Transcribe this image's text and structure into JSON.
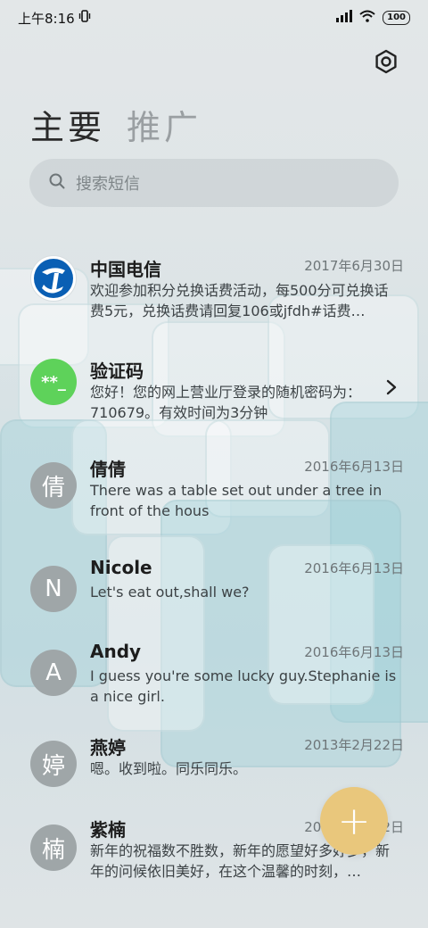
{
  "status_bar": {
    "time": "上午8:16",
    "battery": "100",
    "icons": [
      "vibrate-icon",
      "signal-icon",
      "wifi-icon",
      "battery-icon"
    ]
  },
  "tabs": [
    {
      "label": "主要",
      "active": true
    },
    {
      "label": "推广",
      "active": false
    }
  ],
  "search": {
    "placeholder": "搜索短信",
    "icon": "search-icon"
  },
  "settings": {
    "icon": "gear-icon"
  },
  "messages": [
    {
      "sender": "中国电信",
      "date": "2017年6月30日",
      "preview": "欢迎参加积分兑换话费活动，每500分可兑换话费5元，兑换话费请回复106或jfdh#话费…",
      "avatar": {
        "type": "logo",
        "icon": "china-telecom-logo"
      }
    },
    {
      "sender": "验证码",
      "date": "",
      "preview": "您好！您的网上营业厅登录的随机密码为：710679。有效时间为3分钟",
      "avatar": {
        "type": "code",
        "label": "**_",
        "color": "#5ed25a"
      },
      "has_chevron": true
    },
    {
      "sender": "倩倩",
      "date": "2016年6月13日",
      "preview": "There was a table set out under a tree in front of the hous",
      "avatar": {
        "type": "letter",
        "label": "倩"
      }
    },
    {
      "sender": "Nicole",
      "date": "2016年6月13日",
      "preview": "Let's eat out,shall we?",
      "avatar": {
        "type": "letter",
        "label": "N"
      }
    },
    {
      "sender": "Andy",
      "date": "2016年6月13日",
      "preview": "I guess you're some lucky guy.Stephanie is a nice girl.",
      "avatar": {
        "type": "letter",
        "label": "A"
      }
    },
    {
      "sender": "燕婷",
      "date": "2013年2月22日",
      "preview": "嗯。收到啦。同乐同乐。",
      "avatar": {
        "type": "letter",
        "label": "婷"
      }
    },
    {
      "sender": "紫楠",
      "date": "2013年2月22日",
      "preview": "新年的祝福数不胜数，新年的愿望好多好多，新年的问候依旧美好，在这个温馨的时刻，…",
      "avatar": {
        "type": "letter",
        "label": "楠"
      }
    }
  ],
  "fab": {
    "label": "+",
    "color": "#e9c77c"
  },
  "colors": {
    "accent": "#e9c77c",
    "avatar_gray": "#9fa6a8",
    "code_green": "#5ed25a",
    "telecom_blue": "#0a5fb4"
  }
}
